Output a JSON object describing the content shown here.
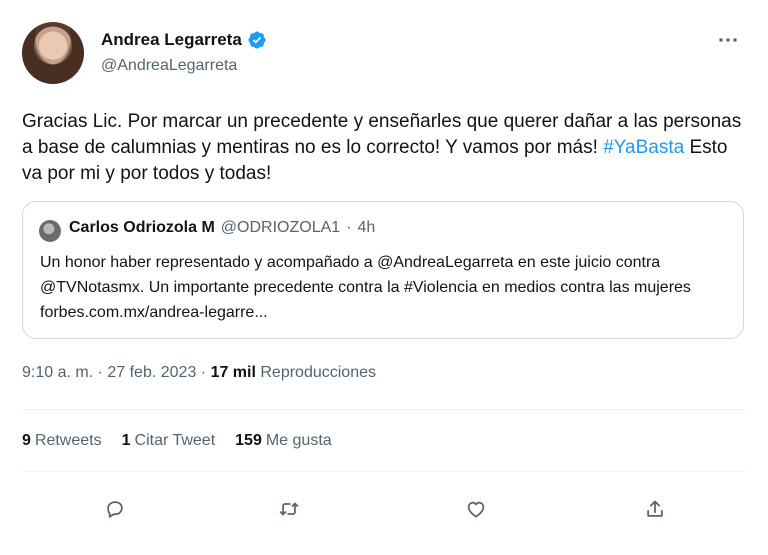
{
  "tweet": {
    "author": {
      "display_name": "Andrea Legarreta",
      "handle": "@AndreaLegarreta",
      "verified": true
    },
    "text_part1": "Gracias Lic. Por marcar un precedente y enseñarles que querer dañar a las personas a base de calumnias y mentiras no es lo correcto! Y vamos por más! ",
    "hashtag": "#YaBasta",
    "text_part2": " Esto va por mi y por todos y todas!",
    "quote": {
      "display_name": "Carlos Odriozola M",
      "handle": "@ODRIOZOLA1",
      "separator": "·",
      "time": "4h",
      "text": "Un honor haber representado y acompañado a @AndreaLegarreta en este juicio contra @TVNotasmx. Un importante precedente contra la #Violencia en medios contra las mujeres forbes.com.mx/andrea-legarre..."
    },
    "meta": {
      "timestamp": "9:10 a. m. · 27 feb. 2023 · ",
      "views_count": "17 mil",
      "views_label": " Reproducciones"
    },
    "stats": {
      "retweets_count": "9",
      "retweets_label": "Retweets",
      "quotes_count": "1",
      "quotes_label": "Citar Tweet",
      "likes_count": "159",
      "likes_label": "Me gusta"
    }
  },
  "icons": {
    "verified": "verified-badge-icon",
    "more": "more-dots-icon",
    "reply": "reply-icon",
    "retweet": "retweet-icon",
    "like": "heart-icon",
    "share": "share-icon"
  },
  "colors": {
    "accent": "#1d9bf0",
    "text_primary": "#0f1419",
    "text_secondary": "#536471",
    "border": "#cfd9de"
  }
}
